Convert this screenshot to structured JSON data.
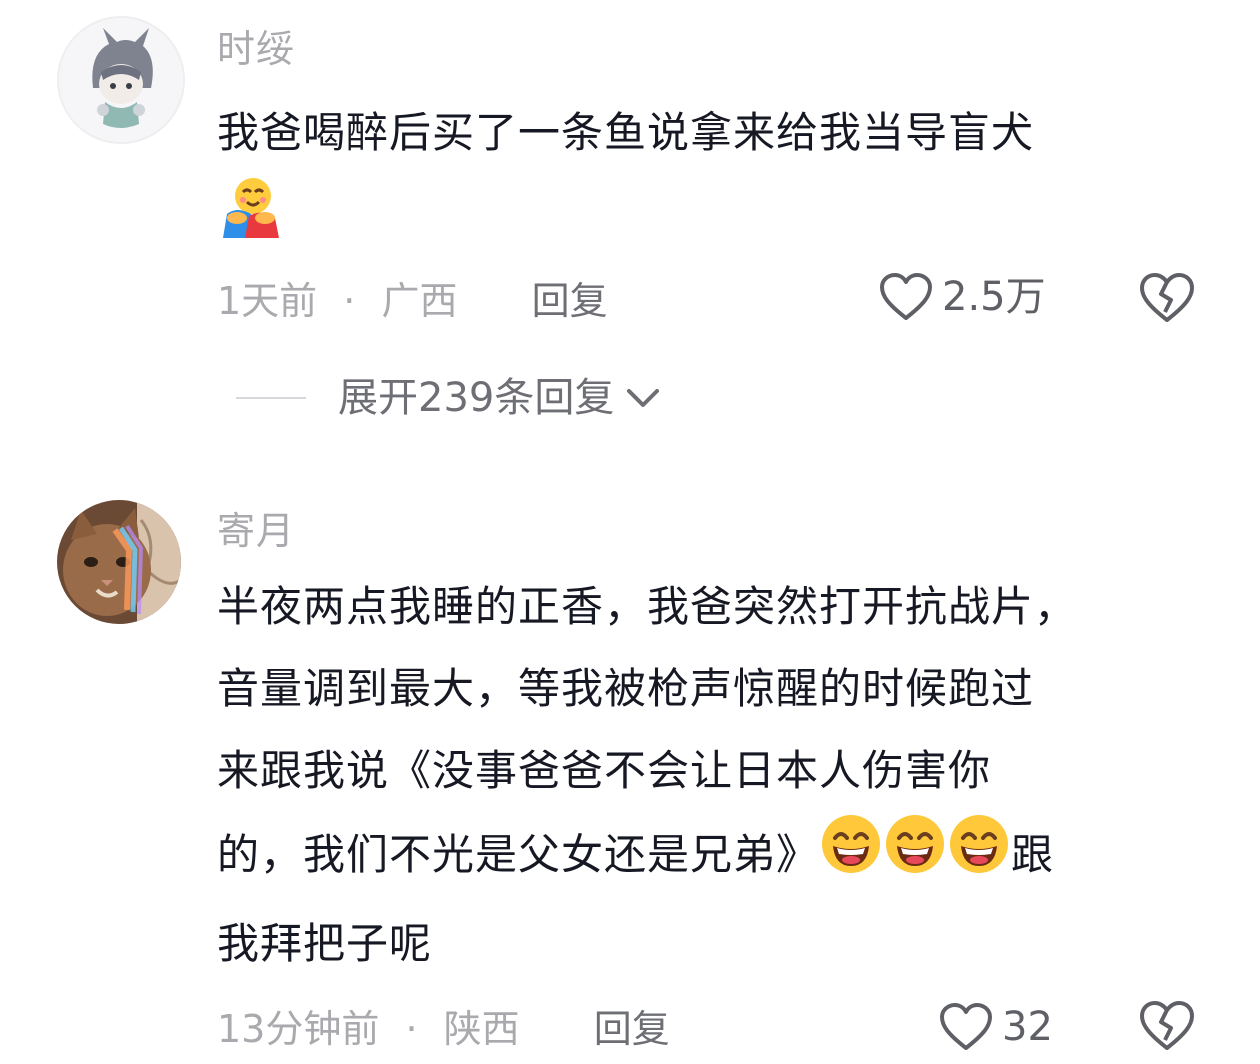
{
  "comments": [
    {
      "username": "时绥",
      "text_lines": [
        "我爸喝醉后买了一条鱼说拿来给我当导盲犬"
      ],
      "emoji": "hug-emoji",
      "time": "1天前",
      "separator": "·",
      "location": "广西",
      "reply_label": "回复",
      "like_count": "2.5万"
    },
    {
      "username": "寄月",
      "text_lines": [
        "半夜两点我睡的正香，我爸突然打开抗战片，",
        "音量调到最大，等我被枪声惊醒的时候跑过",
        "来跟我说《没事爸爸不会让日本人伤害你",
        "的，我们不光是父女还是兄弟》",
        "我拜把子呢"
      ],
      "line4_tail": "跟",
      "emoji": "grin-emoji",
      "time": "13分钟前",
      "separator": "·",
      "location": "陕西",
      "reply_label": "回复",
      "like_count": "32"
    }
  ],
  "expand_replies": "展开239条回复",
  "colors": {
    "text": "#161823",
    "meta": "#a9a9ae",
    "reply": "#6e6f75",
    "icon": "#5f6066"
  }
}
